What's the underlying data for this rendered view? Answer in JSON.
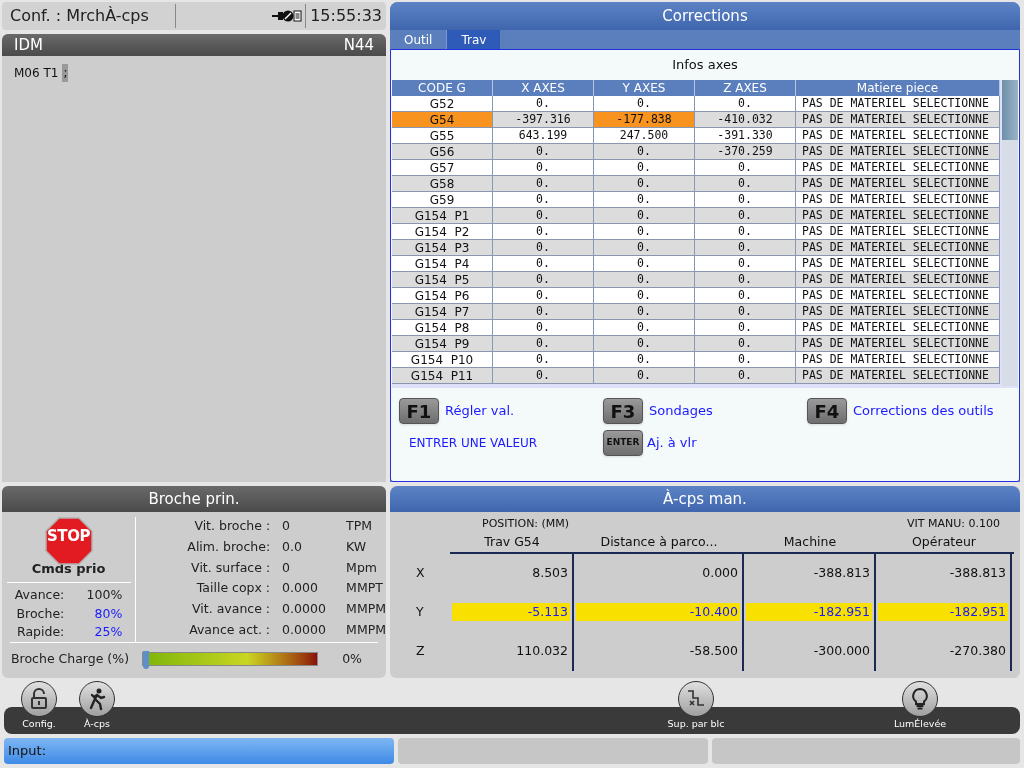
{
  "status": {
    "mode": "Conf. : MrchÀ-cps",
    "time": "15:55:33"
  },
  "program": {
    "title": "IDM",
    "line": "N44",
    "code": "M06 T1",
    "cursor": ";"
  },
  "corrections": {
    "title": "Corrections",
    "tabs": [
      {
        "label": "Outil",
        "selected": false
      },
      {
        "label": "Trav",
        "selected": true
      }
    ],
    "subtitle": "Infos axes",
    "code_column": "CODE G",
    "axis_columns": [
      {
        "label": "X AXES",
        "selected": false
      },
      {
        "label": "Y AXES",
        "selected": true
      },
      {
        "label": "Z AXES",
        "selected": false
      }
    ],
    "material_column": "Matiere piece",
    "rows": [
      {
        "cells": [
          "G52",
          "0.",
          "0.",
          "0.",
          "PAS DE MATERIEL SELECTIONNE"
        ],
        "selected": false
      },
      {
        "cells": [
          "G54",
          "-397.316",
          "-177.838",
          "-410.032",
          "PAS DE MATERIEL SELECTIONNE"
        ],
        "selected": true
      },
      {
        "cells": [
          "G55",
          "643.199",
          "247.500",
          "-391.330",
          "PAS DE MATERIEL SELECTIONNE"
        ],
        "selected": false
      },
      {
        "cells": [
          "G56",
          "0.",
          "0.",
          "-370.259",
          "PAS DE MATERIEL SELECTIONNE"
        ],
        "selected": false
      },
      {
        "cells": [
          "G57",
          "0.",
          "0.",
          "0.",
          "PAS DE MATERIEL SELECTIONNE"
        ],
        "selected": false
      },
      {
        "cells": [
          "G58",
          "0.",
          "0.",
          "0.",
          "PAS DE MATERIEL SELECTIONNE"
        ],
        "selected": false
      },
      {
        "cells": [
          "G59",
          "0.",
          "0.",
          "0.",
          "PAS DE MATERIEL SELECTIONNE"
        ],
        "selected": false
      },
      {
        "cells": [
          "G154  P1",
          "0.",
          "0.",
          "0.",
          "PAS DE MATERIEL SELECTIONNE"
        ],
        "selected": false
      },
      {
        "cells": [
          "G154  P2",
          "0.",
          "0.",
          "0.",
          "PAS DE MATERIEL SELECTIONNE"
        ],
        "selected": false
      },
      {
        "cells": [
          "G154  P3",
          "0.",
          "0.",
          "0.",
          "PAS DE MATERIEL SELECTIONNE"
        ],
        "selected": false
      },
      {
        "cells": [
          "G154  P4",
          "0.",
          "0.",
          "0.",
          "PAS DE MATERIEL SELECTIONNE"
        ],
        "selected": false
      },
      {
        "cells": [
          "G154  P5",
          "0.",
          "0.",
          "0.",
          "PAS DE MATERIEL SELECTIONNE"
        ],
        "selected": false
      },
      {
        "cells": [
          "G154  P6",
          "0.",
          "0.",
          "0.",
          "PAS DE MATERIEL SELECTIONNE"
        ],
        "selected": false
      },
      {
        "cells": [
          "G154  P7",
          "0.",
          "0.",
          "0.",
          "PAS DE MATERIEL SELECTIONNE"
        ],
        "selected": false
      },
      {
        "cells": [
          "G154  P8",
          "0.",
          "0.",
          "0.",
          "PAS DE MATERIEL SELECTIONNE"
        ],
        "selected": false
      },
      {
        "cells": [
          "G154  P9",
          "0.",
          "0.",
          "0.",
          "PAS DE MATERIEL SELECTIONNE"
        ],
        "selected": false
      },
      {
        "cells": [
          "G154  P10",
          "0.",
          "0.",
          "0.",
          "PAS DE MATERIEL SELECTIONNE"
        ],
        "selected": false
      },
      {
        "cells": [
          "G154  P11",
          "0.",
          "0.",
          "0.",
          "PAS DE MATERIEL SELECTIONNE"
        ],
        "selected": false
      }
    ],
    "keys": [
      {
        "key": "F1",
        "label": "Régler val."
      },
      {
        "key": "F3",
        "label": "Sondages"
      },
      {
        "key": "F4",
        "label": "Corrections des outils"
      }
    ],
    "hint": "ENTRER UNE VALEUR",
    "enter": {
      "key": "ENTER",
      "label": "Aj. à vlr"
    }
  },
  "spindle": {
    "title": "Broche prin.",
    "stop": "STOP",
    "stop_label": "Cmds prio",
    "overrides": [
      {
        "label": "Avance:",
        "value": "100%",
        "changed": false
      },
      {
        "label": "Broche:",
        "value": "80%",
        "changed": true
      },
      {
        "label": "Rapide:",
        "value": "25%",
        "changed": true
      }
    ],
    "readings": [
      {
        "label": "Vit. broche :",
        "value": "0",
        "unit": "TPM"
      },
      {
        "label": "Alim. broche:",
        "value": "0.0",
        "unit": "KW"
      },
      {
        "label": "Vit. surface :",
        "value": "0",
        "unit": "Mpm"
      },
      {
        "label": "Taille copx :",
        "value": "0.000",
        "unit": "MMPT"
      },
      {
        "label": "Vit. avance :",
        "value": "0.0000",
        "unit": "MMPM"
      },
      {
        "label": "Avance act. :",
        "value": "0.0000",
        "unit": "MMPM"
      }
    ],
    "load_label": "Broche Charge (%)",
    "load": {
      "level": 0
    },
    "load_reading": "0%"
  },
  "jog": {
    "title": "À-cps man.",
    "position": "POSITION: (MM)",
    "speed": "VIT MANU: 0.100",
    "columns": [
      "Trav G54",
      "Distance à parco...",
      "Machine",
      "Opérateur"
    ],
    "axes": [
      {
        "axis": "X",
        "values": [
          "8.503",
          "0.000",
          "-388.813",
          "-388.813"
        ],
        "selected": false
      },
      {
        "axis": "Y",
        "values": [
          "-5.113",
          "-10.400",
          "-182.951",
          "-182.951"
        ],
        "selected": true
      },
      {
        "axis": "Z",
        "values": [
          "110.032",
          "-58.500",
          "-300.000",
          "-270.380"
        ],
        "selected": false
      }
    ]
  },
  "toolbar": [
    {
      "kind": "lock",
      "label": "Config."
    },
    {
      "kind": "jog",
      "label": "À-cps"
    },
    {
      "kind": "skip",
      "label": "Sup. par blc"
    },
    {
      "kind": "light",
      "label": "LumÉlevée"
    }
  ],
  "input": {
    "label": "Input:"
  }
}
